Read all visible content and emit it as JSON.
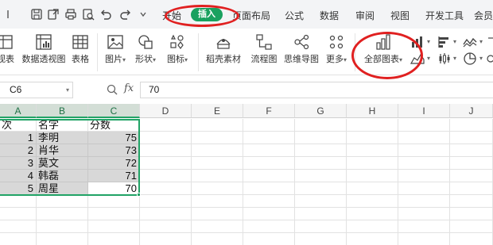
{
  "menu": {
    "tabs": [
      "开始",
      "插入",
      "页面布局",
      "公式",
      "数据",
      "审阅",
      "视图",
      "开发工具",
      "会员"
    ]
  },
  "quick_access": [
    "save-icon",
    "export-icon",
    "print-icon",
    "preview-icon",
    "undo-icon",
    "redo-icon",
    "more-icon"
  ],
  "ribbon": {
    "items": [
      "视表",
      "数据透视图",
      "表格",
      "图片",
      "形状",
      "图标",
      "稻壳素材",
      "流程图",
      "思维导图",
      "更多",
      "全部图表"
    ]
  },
  "formula_bar": {
    "cell_ref": "C6",
    "fx": "fx",
    "value": "70"
  },
  "sheet": {
    "columns": [
      "A",
      "B",
      "C",
      "D",
      "E",
      "F",
      "G",
      "H",
      "I",
      "J"
    ],
    "header_row": [
      "次",
      "名字",
      "分数"
    ],
    "rows": [
      {
        "a": "1",
        "b": "李明",
        "c": "75"
      },
      {
        "a": "2",
        "b": "肖华",
        "c": "73"
      },
      {
        "a": "3",
        "b": "莫文",
        "c": "72"
      },
      {
        "a": "4",
        "b": "韩磊",
        "c": "71"
      },
      {
        "a": "5",
        "b": "周星",
        "c": "70"
      }
    ]
  },
  "colors": {
    "accent": "#19a15f",
    "annotation": "#e02020",
    "selection_fill": "#d8d8d8"
  }
}
